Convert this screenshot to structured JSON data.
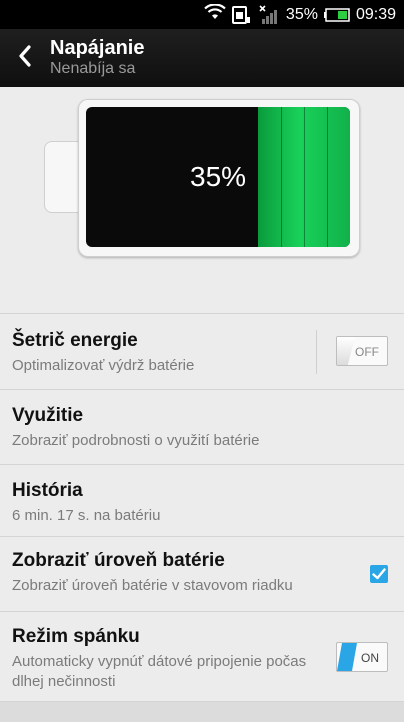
{
  "status_bar": {
    "battery_percent": "35%",
    "time": "09:39",
    "icons": [
      "wifi-icon",
      "sim-icon",
      "signal-icon",
      "battery-icon"
    ]
  },
  "action_bar": {
    "title": "Napájanie",
    "subtitle": "Nenabíja sa"
  },
  "battery_graphic": {
    "percent_label": "35%",
    "level": 0.35,
    "fill_color": "#19d15a"
  },
  "settings": [
    {
      "title": "Šetrič energie",
      "summary": "Optimalizovať výdrž batérie",
      "toggle_label": "OFF"
    },
    {
      "title": "Využitie",
      "summary": "Zobraziť podrobnosti o využití batérie"
    },
    {
      "title": "História",
      "summary": "6 min. 17 s. na batériu"
    },
    {
      "title": "Zobraziť úroveň batérie",
      "summary": "Zobraziť úroveň batérie v stavovom riadku",
      "checked": true
    },
    {
      "title": "Režim spánku",
      "summary": "Automaticky vypnúť dátové pripojenie počas dlhej nečinnosti",
      "toggle_label": "ON"
    }
  ],
  "colors": {
    "accent": "#2aa6e6",
    "battery_green": "#19d15a"
  }
}
